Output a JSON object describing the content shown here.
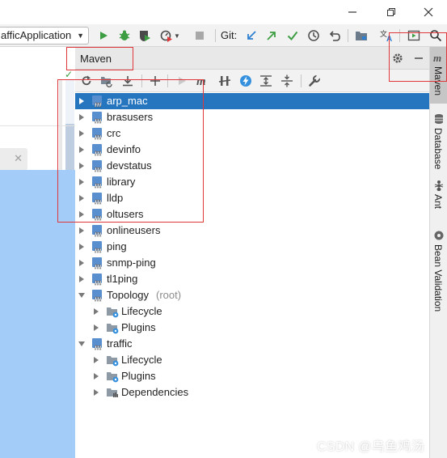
{
  "toolbar": {
    "run_config": "afficApplication",
    "git_label": "Git:"
  },
  "maven_panel": {
    "title": "Maven"
  },
  "tree": {
    "items": [
      {
        "label": "arp_mac",
        "selected": true
      },
      {
        "label": "brasusers"
      },
      {
        "label": "crc"
      },
      {
        "label": "devinfo"
      },
      {
        "label": "devstatus"
      },
      {
        "label": "library"
      },
      {
        "label": "lldp"
      },
      {
        "label": "oltusers"
      },
      {
        "label": "onlineusers"
      },
      {
        "label": "ping"
      },
      {
        "label": "snmp-ping"
      },
      {
        "label": "tl1ping"
      },
      {
        "label": "Topology",
        "suffix": "(root)",
        "expanded": true
      },
      {
        "label": "Lifecycle",
        "child": true
      },
      {
        "label": "Plugins",
        "child": true
      },
      {
        "label": "traffic",
        "expanded": true
      },
      {
        "label": "Lifecycle",
        "child": true
      },
      {
        "label": "Plugins",
        "child": true
      },
      {
        "label": "Dependencies",
        "child": true
      }
    ]
  },
  "right_stripe": {
    "tabs": [
      "Maven",
      "Database",
      "Ant",
      "Bean Validation"
    ]
  },
  "watermark": "CSDN @乌鱼鸡汤",
  "colors": {
    "selection": "#2675bf",
    "annotation_red": "#e0373b",
    "run_green": "#3d9d42",
    "vcs_blue": "#2f7fd1",
    "editor_selection": "#a3ccf9"
  }
}
